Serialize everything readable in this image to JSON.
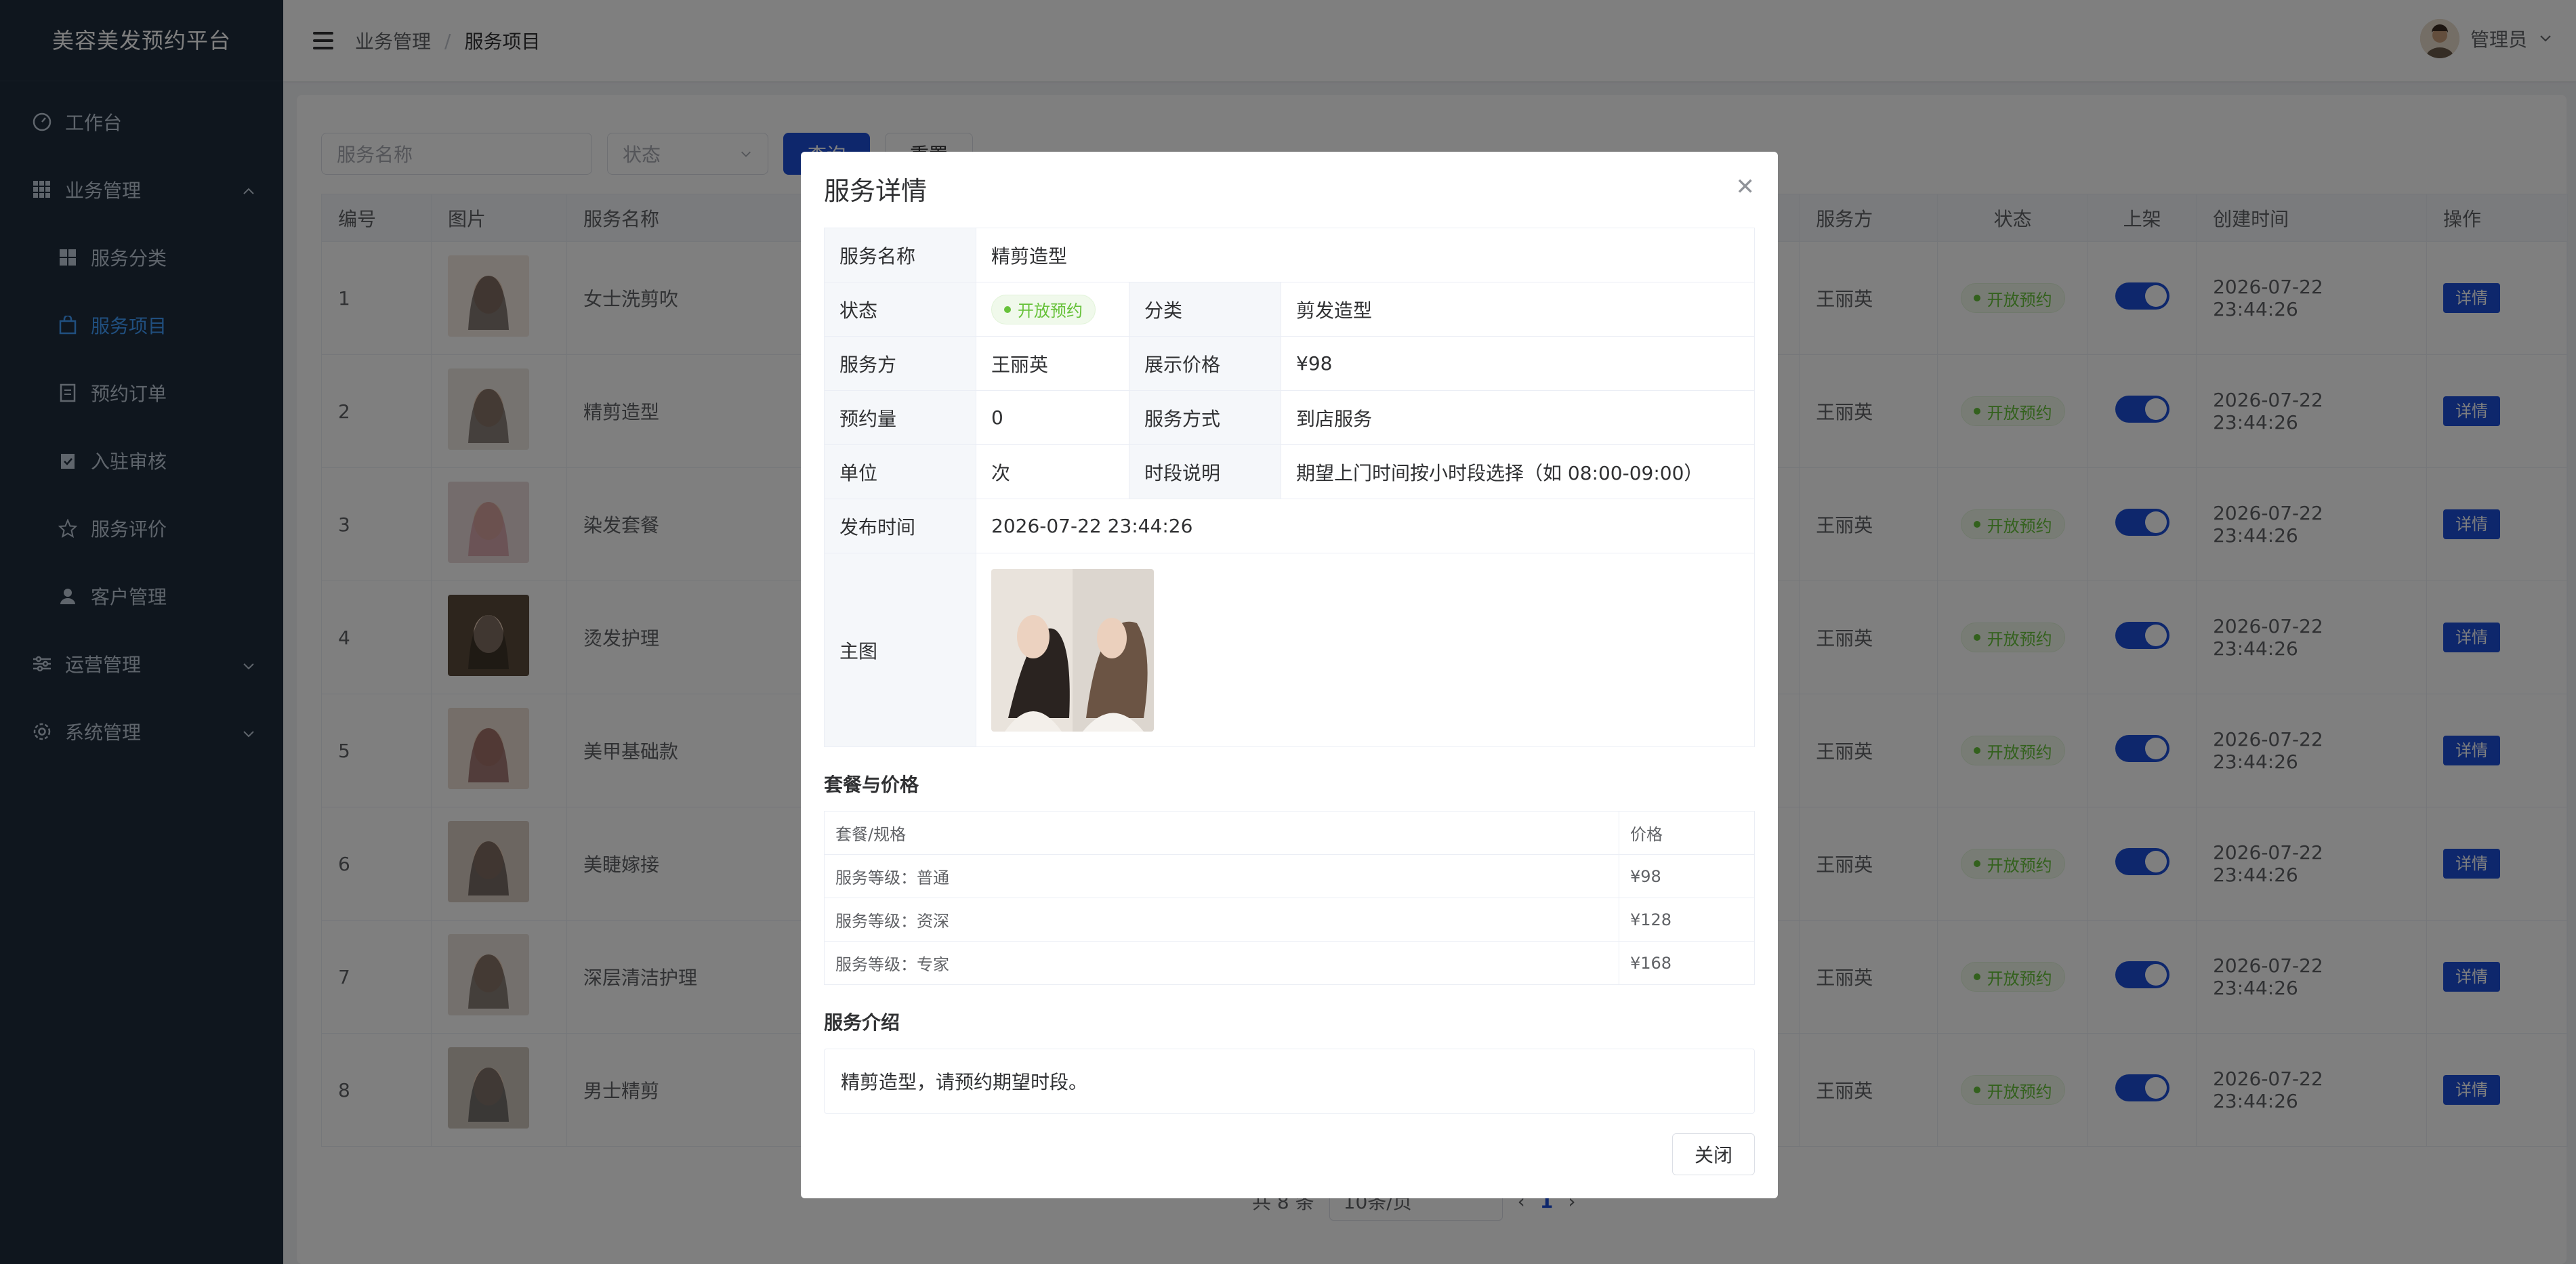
{
  "app": {
    "title": "美容美发预约平台"
  },
  "sidebar": {
    "items": [
      {
        "label": "工作台",
        "icon": "dashboard-icon"
      },
      {
        "label": "业务管理",
        "icon": "grid-icon",
        "expanded": true
      },
      {
        "label": "服务分类",
        "icon": "category-icon"
      },
      {
        "label": "服务项目",
        "icon": "bag-icon",
        "active": true
      },
      {
        "label": "预约订单",
        "icon": "document-icon"
      },
      {
        "label": "入驻审核",
        "icon": "clipboard-icon"
      },
      {
        "label": "服务评价",
        "icon": "star-icon"
      },
      {
        "label": "客户管理",
        "icon": "user-icon"
      },
      {
        "label": "运营管理",
        "icon": "sliders-icon",
        "expanded": false
      },
      {
        "label": "系统管理",
        "icon": "gear-icon",
        "expanded": false
      }
    ]
  },
  "header": {
    "breadcrumb": [
      "业务管理",
      "服务项目"
    ],
    "breadcrumb_sep": "/",
    "user": "管理员"
  },
  "filters": {
    "name_placeholder": "服务名称",
    "status_placeholder": "状态",
    "query": "查询",
    "reset": "重置"
  },
  "table": {
    "columns": [
      "编号",
      "图片",
      "服务名称",
      "服务方",
      "状态",
      "上架",
      "创建时间",
      "操作"
    ],
    "rows": [
      {
        "id": "1",
        "name": "女士洗剪吹",
        "provider": "王丽英",
        "status": "开放预约",
        "created": "2026-07-22 23:44:26",
        "action": "详情",
        "on_shelf": true
      },
      {
        "id": "2",
        "name": "精剪造型",
        "provider": "王丽英",
        "status": "开放预约",
        "created": "2026-07-22 23:44:26",
        "action": "详情",
        "on_shelf": true
      },
      {
        "id": "3",
        "name": "染发套餐",
        "provider": "王丽英",
        "status": "开放预约",
        "created": "2026-07-22 23:44:26",
        "action": "详情",
        "on_shelf": true
      },
      {
        "id": "4",
        "name": "烫发护理",
        "provider": "王丽英",
        "status": "开放预约",
        "created": "2026-07-22 23:44:26",
        "action": "详情",
        "on_shelf": true
      },
      {
        "id": "5",
        "name": "美甲基础款",
        "provider": "王丽英",
        "status": "开放预约",
        "created": "2026-07-22 23:44:26",
        "action": "详情",
        "on_shelf": true
      },
      {
        "id": "6",
        "name": "美睫嫁接",
        "provider": "王丽英",
        "status": "开放预约",
        "created": "2026-07-22 23:44:26",
        "action": "详情",
        "on_shelf": true
      },
      {
        "id": "7",
        "name": "深层清洁护理",
        "provider": "王丽英",
        "status": "开放预约",
        "created": "2026-07-22 23:44:26",
        "action": "详情",
        "on_shelf": true
      },
      {
        "id": "8",
        "name": "男士精剪",
        "provider": "王丽英",
        "status": "开放预约",
        "created": "2026-07-22 23:44:26",
        "action": "详情",
        "on_shelf": true
      }
    ]
  },
  "pagination": {
    "total": "共 8 条",
    "page_size": "10条/页",
    "current": "1"
  },
  "dialog": {
    "title": "服务详情",
    "fields": {
      "name_label": "服务名称",
      "name": "精剪造型",
      "status_label": "状态",
      "status": "开放预约",
      "category_label": "分类",
      "category": "剪发造型",
      "provider_label": "服务方",
      "provider": "王丽英",
      "price_label": "展示价格",
      "price": "¥98",
      "bookings_label": "预约量",
      "bookings": "0",
      "mode_label": "服务方式",
      "mode": "到店服务",
      "unit_label": "单位",
      "unit": "次",
      "slot_label": "时段说明",
      "slot": "期望上门时间按小时段选择（如 08:00-09:00）",
      "published_label": "发布时间",
      "published": "2026-07-22 23:44:26",
      "image_label": "主图"
    },
    "packages_title": "套餐与价格",
    "packages_cols": [
      "套餐/规格",
      "价格"
    ],
    "packages": [
      {
        "spec": "服务等级：普通",
        "price": "¥98"
      },
      {
        "spec": "服务等级：资深",
        "price": "¥128"
      },
      {
        "spec": "服务等级：专家",
        "price": "¥168"
      }
    ],
    "intro_title": "服务介绍",
    "intro": "精剪造型，请预约期望时段。",
    "close": "关闭"
  },
  "colors": {
    "primary": "#1d4fd8",
    "sidebar_bg": "#1f2d3d",
    "success": "#67c23a"
  }
}
